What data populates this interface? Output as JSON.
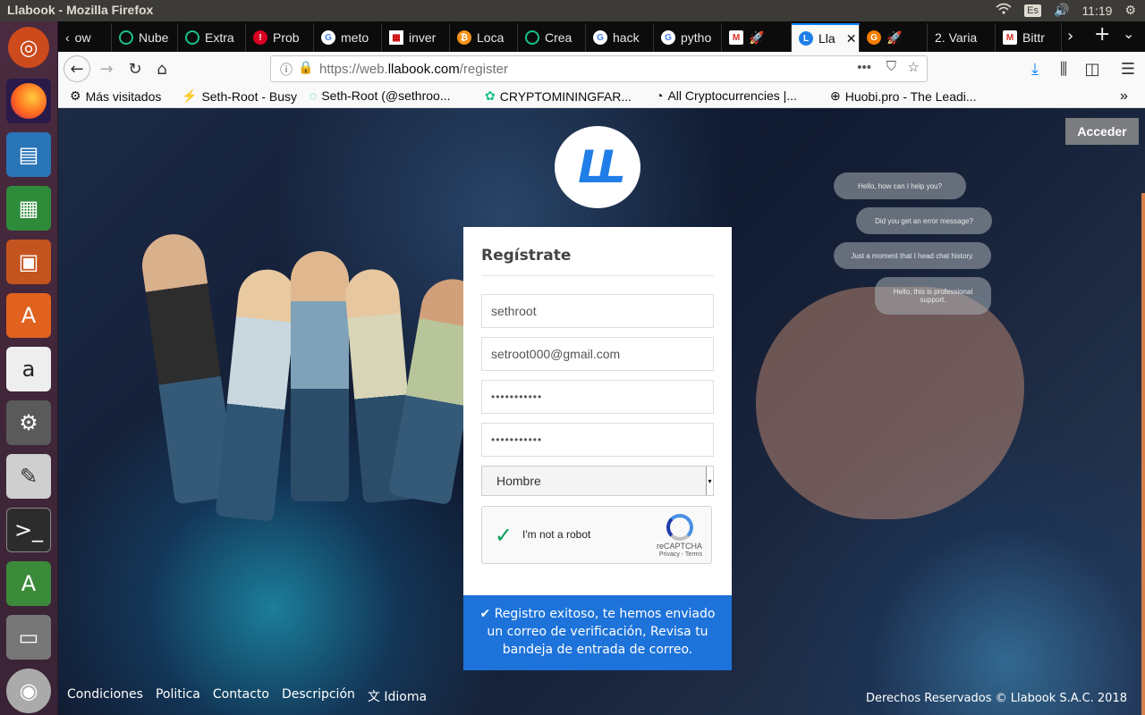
{
  "system": {
    "window_title": "Llabook - Mozilla Firefox",
    "keyboard": "Es",
    "time": "11:19"
  },
  "tabs": [
    {
      "label": "ow",
      "icon": "chevron-icon"
    },
    {
      "label": "Nube",
      "icon": "green-ring-icon"
    },
    {
      "label": "Extra",
      "icon": "green-ring-icon"
    },
    {
      "label": "Prob",
      "icon": "red-alert-icon"
    },
    {
      "label": "meto",
      "icon": "google-icon"
    },
    {
      "label": "inver",
      "icon": "grid-icon"
    },
    {
      "label": "Loca",
      "icon": "bitcoin-icon"
    },
    {
      "label": "Crea",
      "icon": "green-ring-icon"
    },
    {
      "label": "hack",
      "icon": "google-icon"
    },
    {
      "label": "pytho",
      "icon": "google-icon"
    },
    {
      "label": "",
      "icon": "gmail-icon"
    },
    {
      "label": "Lla",
      "icon": "llabook-icon",
      "active": true
    },
    {
      "label": "",
      "icon": "orange-g-icon"
    },
    {
      "label": "2. Varia",
      "icon": ""
    },
    {
      "label": "Bittr",
      "icon": "gmail-icon"
    }
  ],
  "navbar": {
    "url_prefix": "https://web.",
    "url_domain": "llabook.com",
    "url_path": "/register"
  },
  "bookmarks": [
    "Más visitados",
    "Seth-Root - Busy",
    "Seth-Root (@sethroo...",
    "CRYPTOMININGFAR...",
    "All Cryptocurrencies |...",
    "Huobi.pro - The Leadi..."
  ],
  "page": {
    "logo_text": "LL",
    "login_button": "Acceder",
    "chat_bubbles": [
      "Hello, how can I help you?",
      "Did you get an error message?",
      "Just a moment that I head chat history.",
      "Hello, this is professional support."
    ],
    "form": {
      "title": "Regístrate",
      "username": "sethroot",
      "email": "setroot000@gmail.com",
      "password": "•••••••••••",
      "password_confirm": "•••••••••••",
      "gender": "Hombre",
      "captcha_label": "I'm not a robot",
      "captcha_brand": "reCAPTCHA",
      "captcha_links": "Privacy - Terms"
    },
    "success_message": "✔ Registro exitoso, te hemos enviado un correo de verificación, Revisa tu bandeja de entrada de correo.",
    "footer": {
      "links": [
        "Condiciones",
        "Politica",
        "Contacto",
        "Descripción",
        "Idioma"
      ],
      "copyright": "Derechos Reservados © Llabook S.A.C. 2018"
    }
  },
  "colors": {
    "accent": "#1d73d9",
    "firefox_tab_accent": "#0a84ff",
    "captcha_check": "#009e55"
  }
}
